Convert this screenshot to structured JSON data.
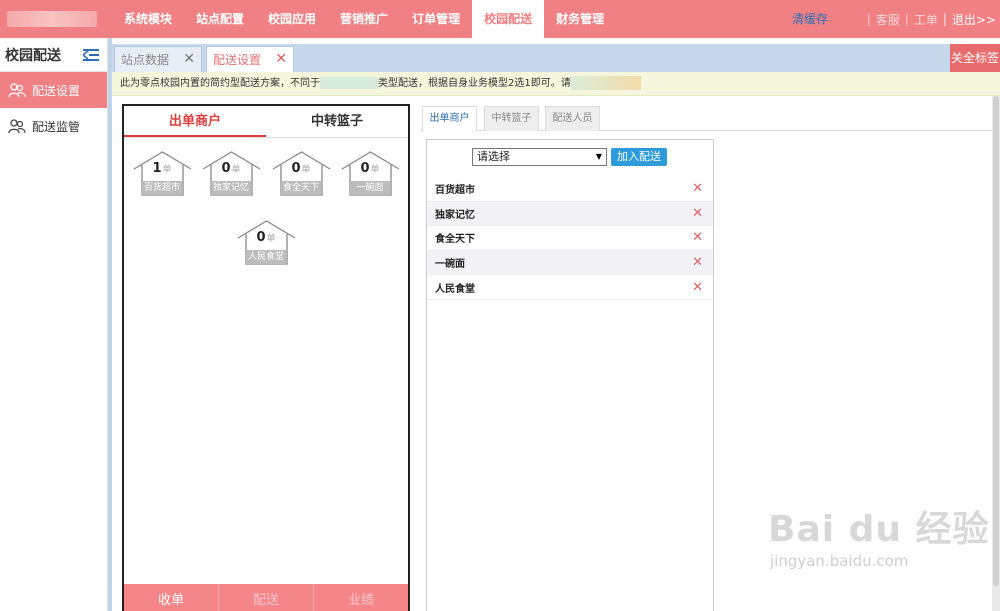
{
  "nav": {
    "items": [
      "系统模块",
      "站点配置",
      "校园应用",
      "营销推广",
      "订单管理",
      "校园配送",
      "财务管理"
    ],
    "active_index": 5,
    "clear_cache": "清缓存",
    "right": {
      "sep": "|",
      "service": "客服",
      "ticket": "工单",
      "logout": "退出>>"
    }
  },
  "sidebar": {
    "title": "校园配送",
    "items": [
      {
        "label": "配送设置",
        "active": true
      },
      {
        "label": "配送监管",
        "active": false
      }
    ]
  },
  "tabs": {
    "items": [
      {
        "label": "站点数据",
        "close": "✕"
      },
      {
        "label": "配送设置",
        "close": "✕"
      }
    ],
    "close_all": "关全标签"
  },
  "notice": {
    "part1": "此为零点校园内置的简约型配送方案，不同于",
    "part2": "类型配送，根据自身业务模型2选1即可。请"
  },
  "phone": {
    "tabs": [
      "出单商户",
      "中转篮子"
    ],
    "unit": "单",
    "merchants": [
      {
        "name": "百货超市",
        "count": "1"
      },
      {
        "name": "独家记忆",
        "count": "0"
      },
      {
        "name": "食全天下",
        "count": "0"
      },
      {
        "name": "一碗面",
        "count": "0"
      },
      {
        "name": "人民食堂",
        "count": "0"
      }
    ],
    "footer": [
      "收单",
      "配送",
      "业绩"
    ]
  },
  "config": {
    "tabs": [
      "出单商户",
      "中转篮子",
      "配送人员"
    ],
    "select_value": "请选择",
    "add_button": "加入配送",
    "delete_icon": "✕",
    "list": [
      "百货超市",
      "独家记忆",
      "食全天下",
      "一碗面",
      "人民食堂"
    ]
  },
  "watermark": {
    "brand": "Bai du 经验",
    "url": "jingyan.baidu.com"
  },
  "colors": {
    "primary": "#f08083",
    "link": "#2e6fb8",
    "button": "#2d9ad9"
  }
}
